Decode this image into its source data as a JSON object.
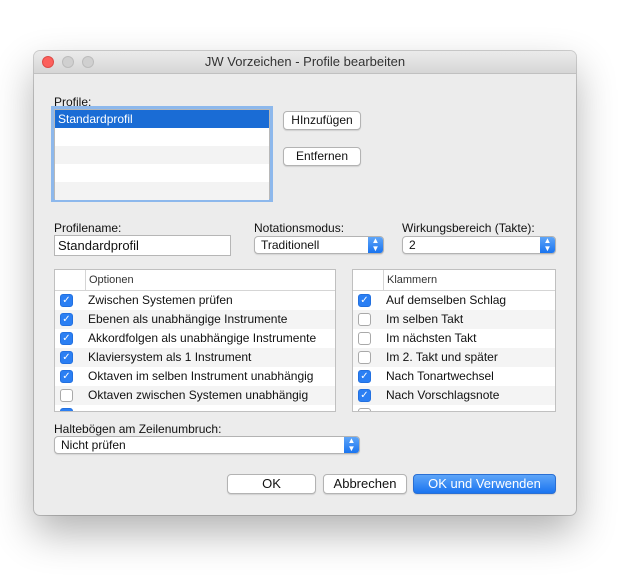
{
  "window": {
    "title": "JW Vorzeichen - Profile bearbeiten"
  },
  "profiles": {
    "label": "Profile:",
    "items": [
      "Standardprofil",
      "",
      "",
      "",
      ""
    ],
    "add_button": "HInzufügen",
    "remove_button": "Entfernen"
  },
  "profilename": {
    "label": "Profilename:",
    "value": "Standardprofil"
  },
  "notation": {
    "label": "Notationsmodus:",
    "value": "Traditionell"
  },
  "range": {
    "label": "Wirkungsbereich (Takte):",
    "value": "2"
  },
  "options_table": {
    "header": "Optionen",
    "rows": [
      {
        "label": "Zwischen Systemen prüfen",
        "checked": true
      },
      {
        "label": "Ebenen als unabhängige Instrumente",
        "checked": true
      },
      {
        "label": "Akkordfolgen als unabhängige Instrumente",
        "checked": true
      },
      {
        "label": "Klaviersystem als 1 Instrument",
        "checked": true
      },
      {
        "label": "Oktaven im selben Instrument unabhängig",
        "checked": true
      },
      {
        "label": "Oktaven zwischen Systemen unabhängig",
        "checked": false
      }
    ]
  },
  "brackets_table": {
    "header": "Klammern",
    "rows": [
      {
        "label": "Auf demselben Schlag",
        "checked": true
      },
      {
        "label": "Im selben Takt",
        "checked": false
      },
      {
        "label": "Im nächsten Takt",
        "checked": false
      },
      {
        "label": "Im 2. Takt und später",
        "checked": false
      },
      {
        "label": "Nach Tonartwechsel",
        "checked": true
      },
      {
        "label": "Nach Vorschlagsnote",
        "checked": true
      }
    ]
  },
  "ties": {
    "label": "Haltebögen am Zeilenumbruch:",
    "value": "Nicht prüfen"
  },
  "buttons": {
    "ok": "OK",
    "cancel": "Abbrechen",
    "ok_apply": "OK und Verwenden"
  },
  "icons": {
    "check": "✓",
    "arrow_up": "▲",
    "arrow_down": "▼"
  }
}
